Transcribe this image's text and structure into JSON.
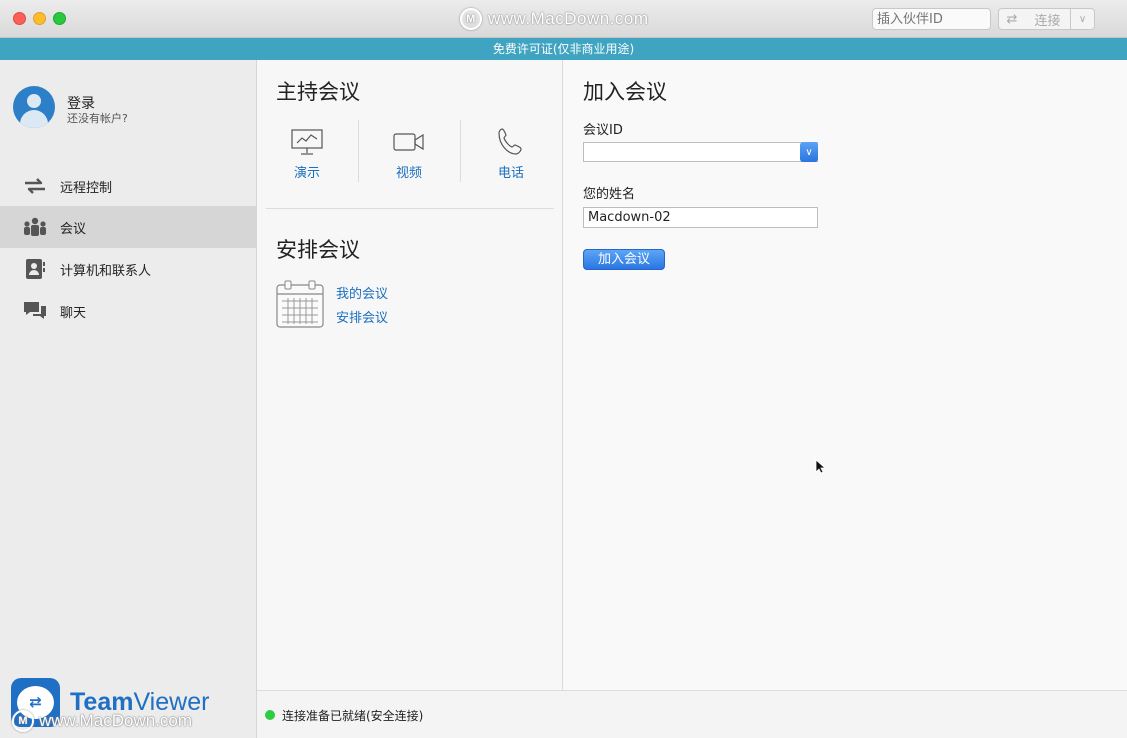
{
  "titlebar": {
    "watermark": "www.MacDown.com",
    "partner_placeholder": "插入伙伴ID",
    "connect_label": "连接"
  },
  "license_banner": "免费许可证(仅非商业用途)",
  "sidebar": {
    "login_label": "登录",
    "no_account": "还没有帐户?",
    "items": [
      {
        "label": "远程控制",
        "icon": "arrows-exchange-icon"
      },
      {
        "label": "会议",
        "icon": "meeting-people-icon",
        "active": true
      },
      {
        "label": "计算机和联系人",
        "icon": "contacts-icon"
      },
      {
        "label": "聊天",
        "icon": "chat-bubbles-icon"
      }
    ],
    "brand_bold": "Team",
    "brand_regular": "Viewer",
    "watermark": "www.MacDown.com"
  },
  "host": {
    "title": "主持会议",
    "options": [
      {
        "label": "演示",
        "icon": "presentation-monitor-icon"
      },
      {
        "label": "视频",
        "icon": "video-camera-icon"
      },
      {
        "label": "电话",
        "icon": "phone-icon"
      }
    ],
    "schedule_title": "安排会议",
    "schedule_links": [
      "我的会议",
      "安排会议"
    ]
  },
  "join": {
    "title": "加入会议",
    "meeting_id_label": "会议ID",
    "meeting_id_value": "",
    "name_label": "您的姓名",
    "name_value": "Macdown-02",
    "join_button": "加入会议"
  },
  "status": {
    "text": "连接准备已就绪(安全连接)",
    "color": "#2ecc40"
  },
  "colors": {
    "accent": "#1b6fbf",
    "license_bar": "#3fa3c2",
    "brand": "#1f6fc5"
  }
}
